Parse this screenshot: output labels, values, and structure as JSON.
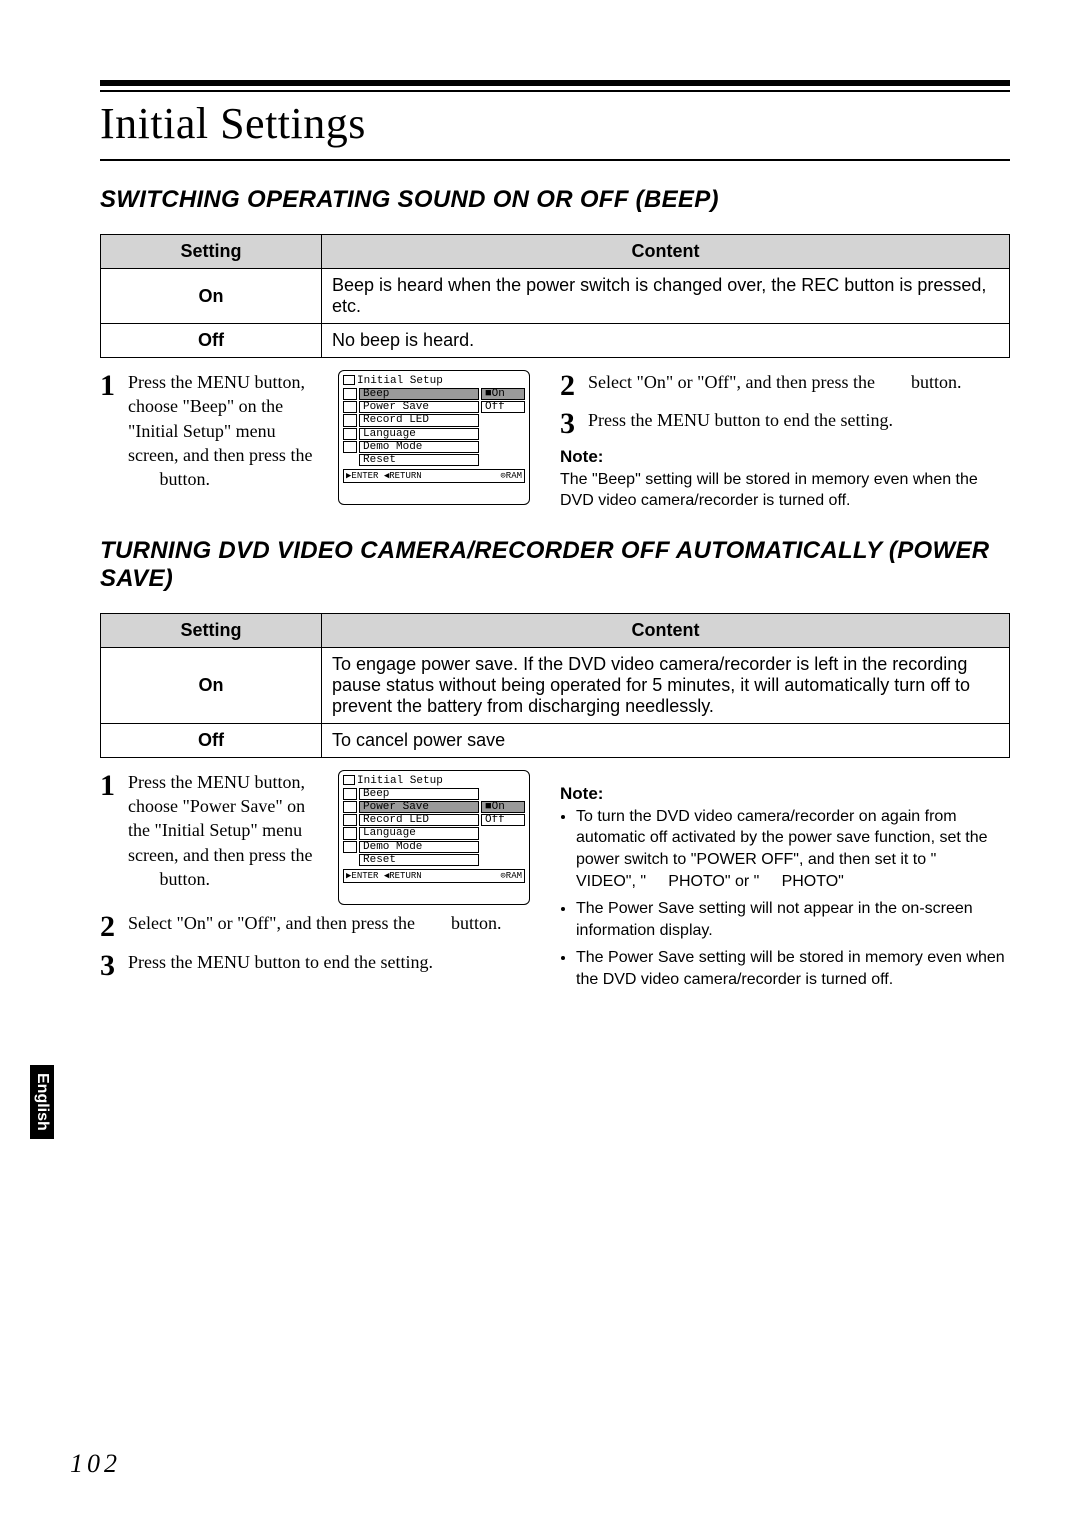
{
  "page": {
    "title": "Initial Settings",
    "number": "102",
    "side_tab": "English"
  },
  "section1": {
    "heading": "SWITCHING OPERATING SOUND ON OR OFF (BEEP)",
    "table": {
      "head_setting": "Setting",
      "head_content": "Content",
      "rows": [
        {
          "setting": "On",
          "content": "Beep is heard when the power switch is changed over, the REC button is pressed, etc."
        },
        {
          "setting": "Off",
          "content": "No beep is heard."
        }
      ]
    },
    "steps_left": {
      "s1_num": "1",
      "s1_text": "Press the MENU button, choose \"Beep\" on the \"Initial Setup\" menu screen, and then press the        button."
    },
    "steps_right": {
      "s2_num": "2",
      "s2_text": "Select \"On\" or \"Off\", and then press the        button.",
      "s3_num": "3",
      "s3_text": "Press the MENU button to end the setting."
    },
    "note_head": "Note:",
    "note_body": "The \"Beep\" setting will be stored in memory even when the DVD video camera/recorder is turned off.",
    "menu": {
      "title": "Initial Setup",
      "items": [
        "Beep",
        "Power Save",
        "Record LED",
        "Language",
        "Demo Mode",
        "Reset"
      ],
      "vals": [
        "■On",
        "Off",
        "",
        "",
        "",
        ""
      ],
      "selected_index": 0,
      "foot_left": "▶ENTER ◀RETURN",
      "foot_right": "⊙RAM"
    }
  },
  "section2": {
    "heading": "TURNING DVD VIDEO CAMERA/RECORDER OFF AUTOMATICALLY (POWER SAVE)",
    "table": {
      "head_setting": "Setting",
      "head_content": "Content",
      "rows": [
        {
          "setting": "On",
          "content": "To engage power save. If the DVD video camera/recorder is left in the recording pause status without being operated for 5 minutes, it will automatically turn off to prevent the battery from discharging needlessly."
        },
        {
          "setting": "Off",
          "content": "To cancel power save"
        }
      ]
    },
    "steps_left": {
      "s1_num": "1",
      "s1_text": "Press the MENU button, choose \"Power Save\" on the \"Initial Setup\" menu screen, and then press the        button.",
      "s2_num": "2",
      "s2_text": "Select \"On\" or \"Off\", and then press the        button.",
      "s3_num": "3",
      "s3_text": "Press the MENU button to end the setting."
    },
    "note_head": "Note:",
    "notes": [
      "To turn the DVD video camera/recorder on again from automatic off activated by the power save function, set the power switch to \"POWER OFF\", and then set it to \"     VIDEO\", \"     PHOTO\" or \"     PHOTO\"",
      "The Power Save setting will not appear in the on-screen information display.",
      "The Power Save setting will be stored in memory even when the DVD video camera/recorder is turned off."
    ],
    "menu": {
      "title": "Initial Setup",
      "items": [
        "Beep",
        "Power Save",
        "Record LED",
        "Language",
        "Demo Mode",
        "Reset"
      ],
      "vals": [
        "",
        "■On",
        "Off",
        "",
        "",
        ""
      ],
      "selected_index": 1,
      "foot_left": "▶ENTER ◀RETURN",
      "foot_right": "⊙RAM"
    }
  }
}
